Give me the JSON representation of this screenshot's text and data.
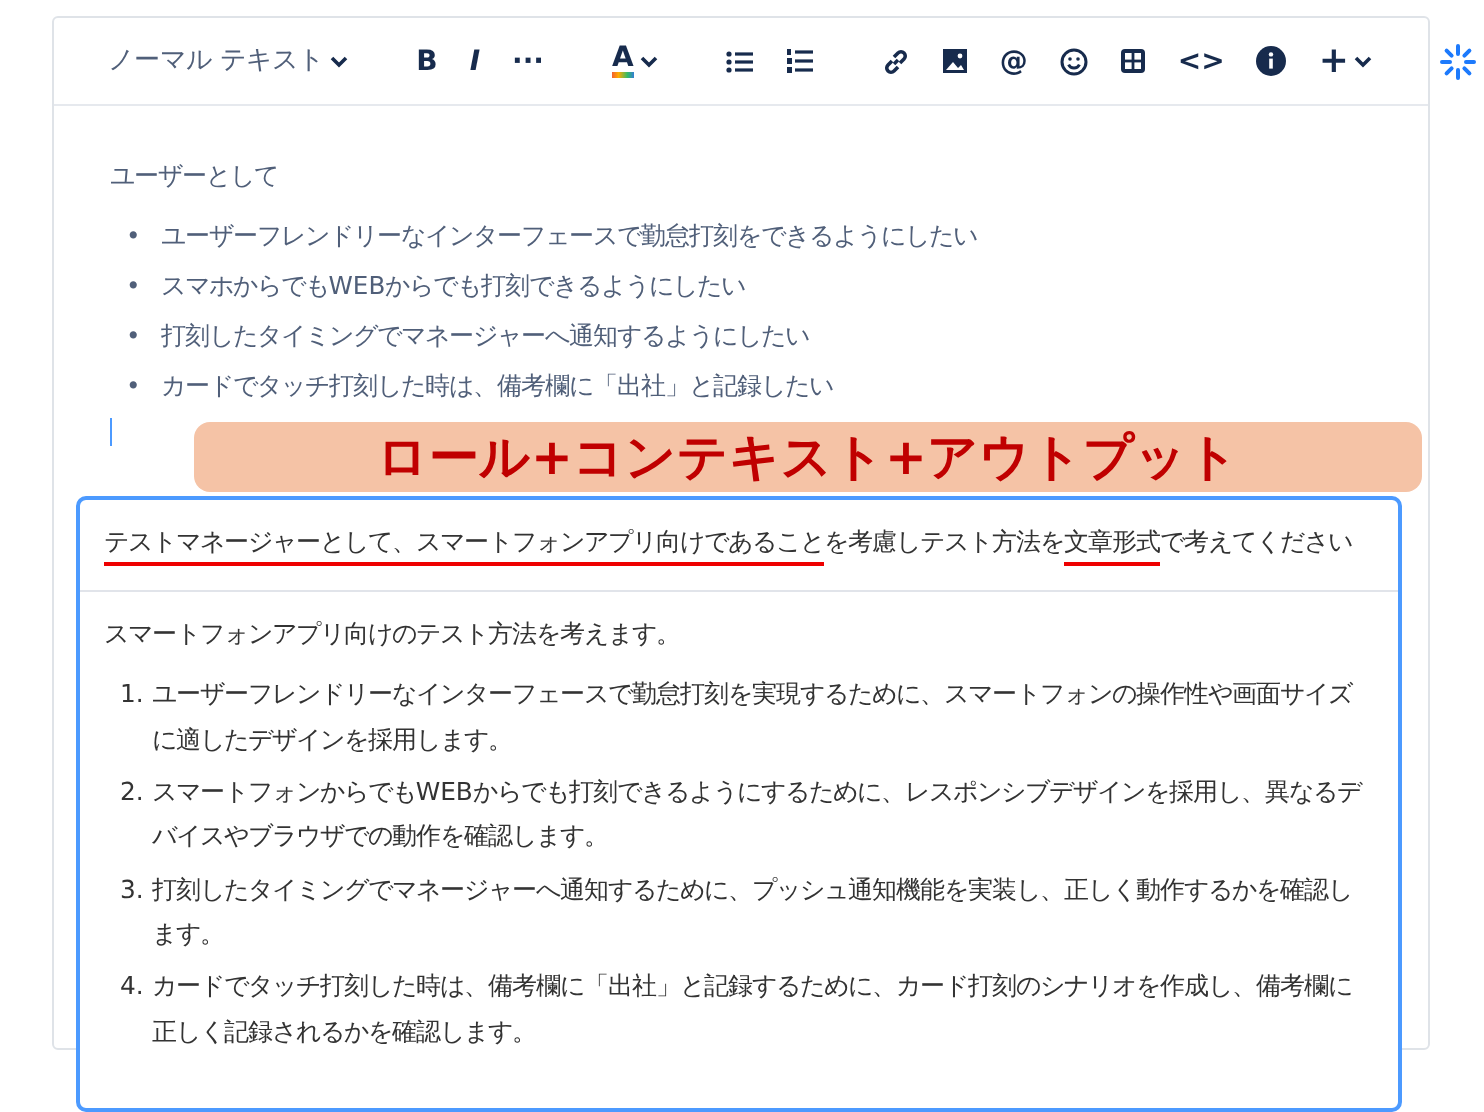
{
  "toolbar": {
    "text_style": "ノーマル テキスト",
    "bold": "B",
    "italic": "I",
    "more": "···",
    "text_color": "A",
    "mention": "@",
    "code": "<>",
    "insert": "+"
  },
  "document": {
    "intro": "ユーザーとして",
    "bullets": [
      {
        "marker": "•",
        "text": "ユーザーフレンドリーなインターフェースで勤怠打刻をできるようにしたい"
      },
      {
        "marker": "•",
        "text": "スマホからでもWEBからでも打刻できるようにしたい"
      },
      {
        "marker": "•",
        "text": "打刻したタイミングでマネージャーへ通知するようにしたい"
      },
      {
        "marker": "•",
        "text": "カードでタッチ打刻した時は、備考欄に「出社」と記録したい"
      }
    ]
  },
  "banner": {
    "text": "ロール+コンテキスト+アウトプット"
  },
  "ai_prompt": {
    "segments": [
      {
        "text": "テストマネージャーとして、",
        "underlined": true
      },
      {
        "text": "スマートフォンアプリ向けであること",
        "underlined": true
      },
      {
        "text": "を考慮しテスト方法を",
        "underlined": false
      },
      {
        "text": "文章形式",
        "underlined": true
      },
      {
        "text": "で考えてください",
        "underlined": false
      }
    ]
  },
  "ai_answer": {
    "intro": "スマートフォンアプリ向けのテスト方法を考えます。",
    "steps": [
      {
        "number": "1.",
        "text": "ユーザーフレンドリーなインターフェースで勤怠打刻を実現するために、スマートフォンの操作性や画面サイズに適したデザインを採用します。"
      },
      {
        "number": "2.",
        "text": "スマートフォンからでもWEBからでも打刻できるようにするために、レスポンシブデザインを採用し、異なるデバイスやブラウザでの動作を確認します。"
      },
      {
        "number": "3.",
        "text": "打刻したタイミングでマネージャーへ通知するために、プッシュ通知機能を実装し、正しく動作するかを確認します。"
      },
      {
        "number": "4.",
        "text": "カードでタッチ打刻した時は、備考欄に「出社」と記録するために、カード打刻のシナリオを作成し、備考欄に正しく記録されるかを確認します。"
      }
    ]
  }
}
